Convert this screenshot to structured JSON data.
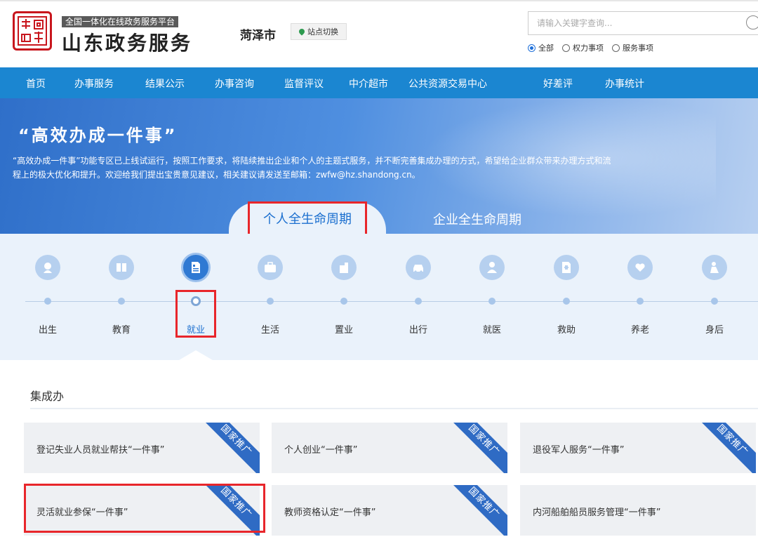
{
  "header": {
    "platform_tag": "全国一体化在线政务服务平台",
    "site_title": "山东政务服务",
    "city": "菏泽市",
    "site_switch": "站点切换",
    "search_placeholder": "请输入关键字查询...",
    "radios": [
      {
        "label": "全部",
        "checked": true
      },
      {
        "label": "权力事项",
        "checked": false
      },
      {
        "label": "服务事项",
        "checked": false
      }
    ]
  },
  "nav": {
    "items": [
      "首页",
      "办事服务",
      "结果公示",
      "办事咨询",
      "监督评议",
      "中介超市",
      "公共资源交易中心",
      "好差评",
      "办事统计"
    ]
  },
  "banner": {
    "title": "“高效办成一件事”",
    "desc_line1": "“高效办成一件事”功能专区已上线试运行，按照工作要求，将陆续推出企业和个人的主题式服务，并不断完善集成办理的方式，希望给企业群众带来办理方式和流",
    "desc_line2": "程上的极大优化和提升。欢迎给我们提出宝贵意见建议，相关建议请发送至邮箱：zwfw@hz.shandong.cn。",
    "tab_personal": "个人全生命周期",
    "tab_enterprise": "企业全生命周期"
  },
  "stages": {
    "items": [
      "出生",
      "教育",
      "就业",
      "生活",
      "置业",
      "出行",
      "就医",
      "救助",
      "养老",
      "身后"
    ],
    "active": "就业"
  },
  "section": {
    "title": "集成办",
    "ribbon": "国家推广",
    "cards": [
      {
        "label": "登记失业人员就业帮扶“一件事”",
        "ribbon": true
      },
      {
        "label": "个人创业“一件事”",
        "ribbon": true
      },
      {
        "label": "退役军人服务“一件事”",
        "ribbon": true
      },
      {
        "label": "灵活就业参保“一件事”",
        "ribbon": true
      },
      {
        "label": "教师资格认定“一件事”",
        "ribbon": true
      },
      {
        "label": "内河船舶船员服务管理“一件事”",
        "ribbon": false
      }
    ]
  },
  "colors": {
    "nav_bg": "#1b86d1",
    "accent": "#1b6fcf",
    "highlight": "#e8262b",
    "ribbon": "#2f6bc4"
  }
}
